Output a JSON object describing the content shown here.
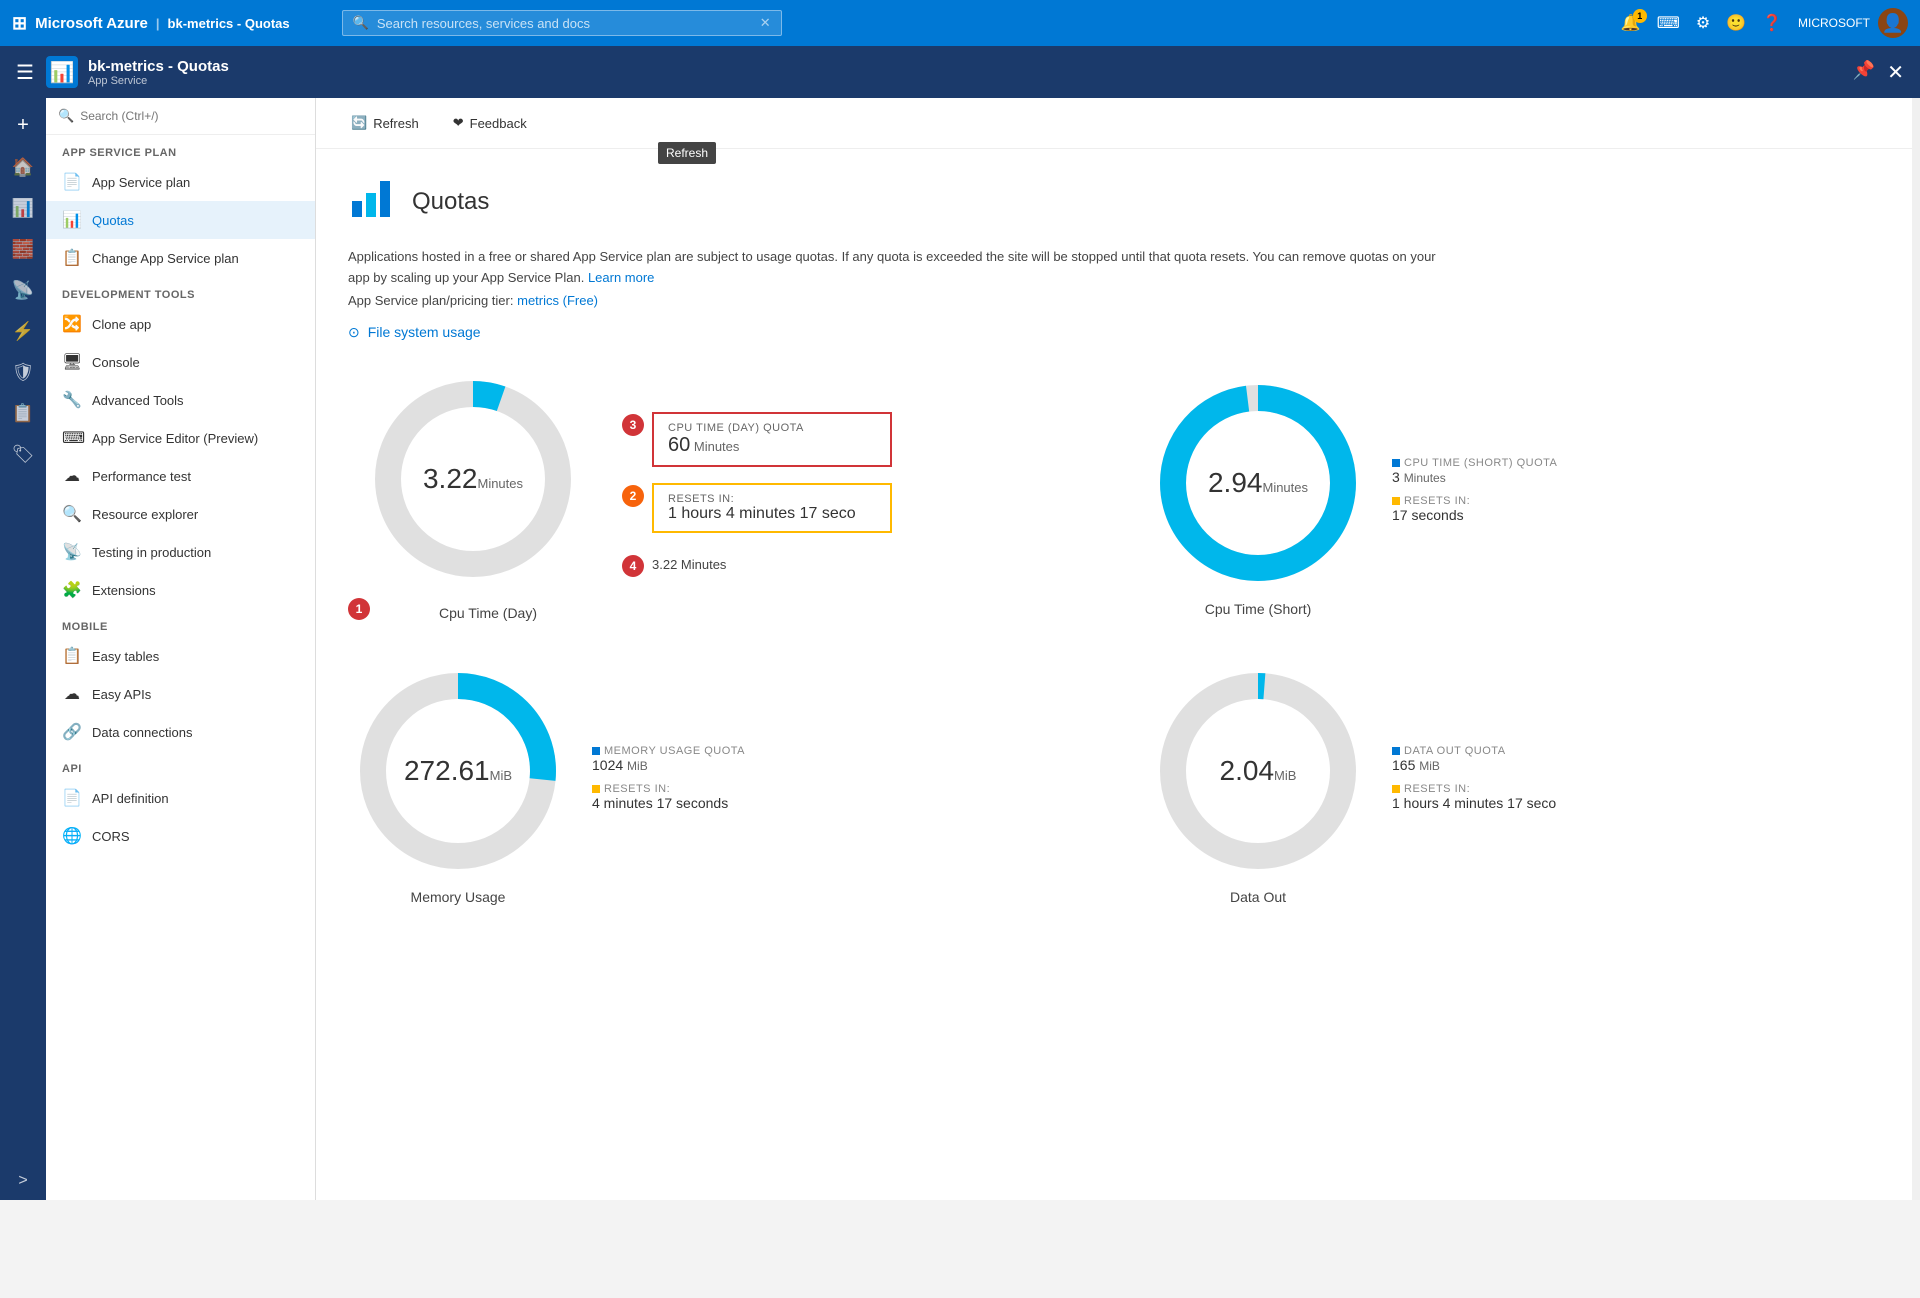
{
  "topbar": {
    "brand": "Microsoft Azure",
    "resource_path": "bk-metrics - Quotas",
    "search_placeholder": "Search resources, services and docs",
    "notifications_count": "1",
    "user_label": "MICROSOFT"
  },
  "secondbar": {
    "app_name": "bk-metrics - Quotas",
    "app_type": "App Service"
  },
  "toolbar": {
    "refresh_label": "Refresh",
    "feedback_label": "Feedback",
    "tooltip": "Refresh"
  },
  "sidebar": {
    "search_placeholder": "Search (Ctrl+/)",
    "sections": [
      {
        "label": "APP SERVICE PLAN",
        "items": [
          {
            "name": "App Service plan",
            "icon": "📄"
          },
          {
            "name": "Quotas",
            "icon": "📊",
            "active": true
          },
          {
            "name": "Change App Service plan",
            "icon": "📋"
          }
        ]
      },
      {
        "label": "DEVELOPMENT TOOLS",
        "items": [
          {
            "name": "Clone app",
            "icon": "🔀"
          },
          {
            "name": "Console",
            "icon": "🖥"
          },
          {
            "name": "Advanced Tools",
            "icon": "🔧"
          },
          {
            "name": "App Service Editor (Preview)",
            "icon": "⌨"
          },
          {
            "name": "Performance test",
            "icon": "☁"
          },
          {
            "name": "Resource explorer",
            "icon": "🔍"
          },
          {
            "name": "Testing in production",
            "icon": "📡"
          },
          {
            "name": "Extensions",
            "icon": "🧩"
          }
        ]
      },
      {
        "label": "MOBILE",
        "items": [
          {
            "name": "Easy tables",
            "icon": "📋"
          },
          {
            "name": "Easy APIs",
            "icon": "☁"
          },
          {
            "name": "Data connections",
            "icon": "🔗"
          }
        ]
      },
      {
        "label": "API",
        "items": [
          {
            "name": "API definition",
            "icon": "📄"
          },
          {
            "name": "CORS",
            "icon": "🌐"
          }
        ]
      }
    ]
  },
  "page": {
    "title": "Quotas",
    "description": "Applications hosted in a free or shared App Service plan are subject to usage quotas. If any quota is exceeded the site will be stopped until that quota resets. You can remove quotas on your app by scaling up your App Service Plan.",
    "learn_more_label": "Learn more",
    "plan_info": "App Service plan/pricing tier:",
    "plan_link": "metrics (Free)",
    "file_usage_label": "File system usage"
  },
  "charts": [
    {
      "id": "cpu_day",
      "label": "Cpu Time (Day)",
      "value": "3.22",
      "unit": "Minutes",
      "percent": 5.37,
      "color": "#00b7eb",
      "quota_label": "CPU TIME (DAY) QUOTA",
      "quota_value": "60",
      "quota_unit": "Minutes",
      "resets_label": "RESETS IN:",
      "resets_value": "1 hours 4 minutes 17 seco",
      "badge1": "1",
      "badge2": "2",
      "badge3": "3",
      "badge4": "4",
      "has_callouts": true
    },
    {
      "id": "cpu_short",
      "label": "Cpu Time (Short)",
      "value": "2.94",
      "unit": "Minutes",
      "percent": 98,
      "color": "#00b7eb",
      "quota_label": "CPU TIME (SHORT) QUOTA",
      "quota_value": "3",
      "quota_unit": "Minutes",
      "resets_label": "RESETS IN:",
      "resets_value": "17 seconds",
      "has_callouts": false
    },
    {
      "id": "memory",
      "label": "Memory Usage",
      "value": "272.61",
      "unit": "MiB",
      "percent": 26.6,
      "color": "#00b7eb",
      "quota_label": "MEMORY USAGE QUOTA",
      "quota_value": "1024",
      "quota_unit": "MiB",
      "resets_label": "RESETS IN:",
      "resets_value": "4 minutes 17 seconds",
      "has_callouts": false
    },
    {
      "id": "data_out",
      "label": "Data Out",
      "value": "2.04",
      "unit": "MiB",
      "percent": 1.2,
      "color": "#00b7eb",
      "quota_label": "DATA OUT QUOTA",
      "quota_value": "165",
      "quota_unit": "MiB",
      "resets_label": "RESETS IN:",
      "resets_value": "1 hours 4 minutes 17 seco",
      "has_callouts": false
    }
  ]
}
